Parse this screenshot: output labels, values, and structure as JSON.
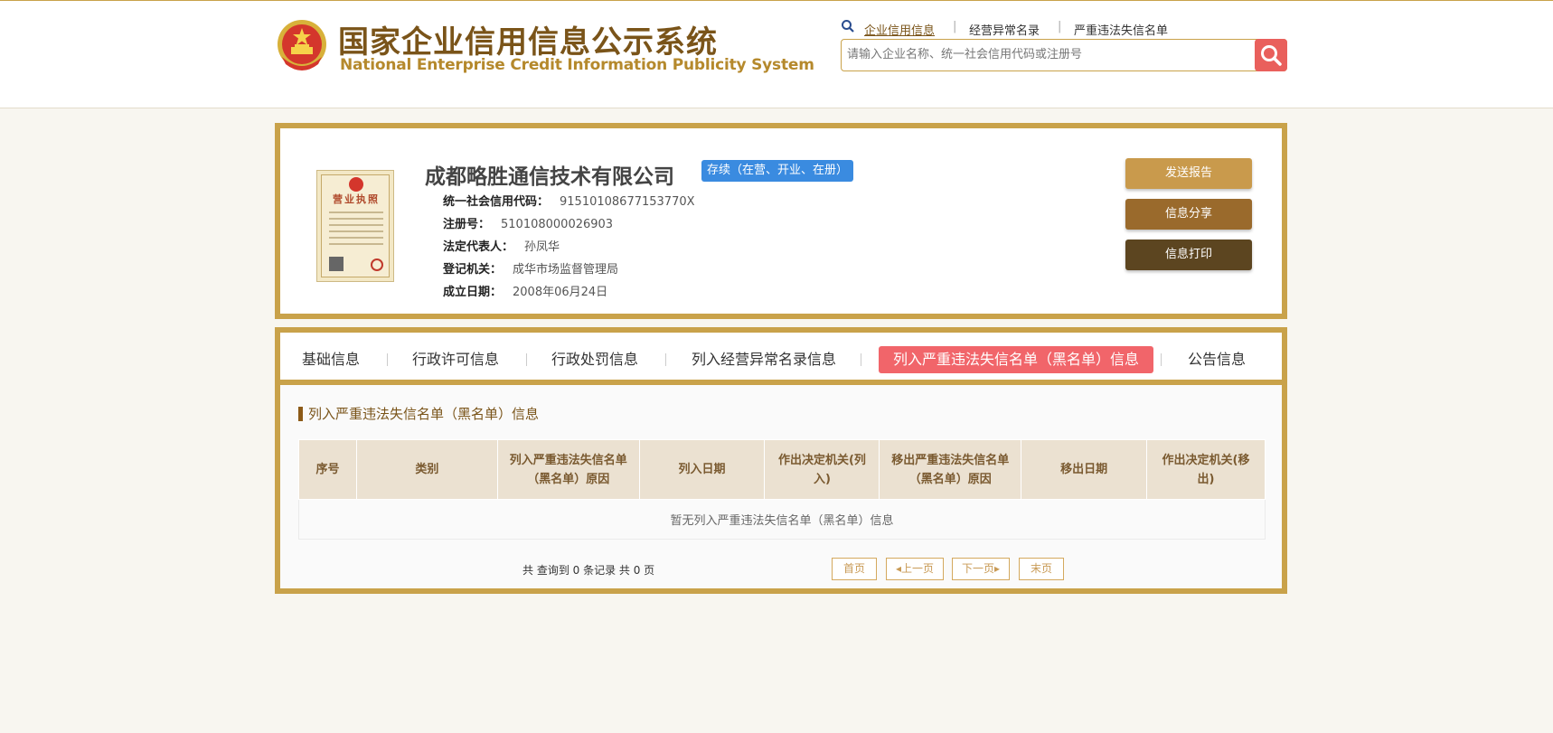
{
  "header": {
    "title_cn": "国家企业信用信息公示系统",
    "title_en": "National Enterprise Credit Information Publicity System",
    "nav": {
      "credit_info": "企业信用信息",
      "abnormal_list": "经营异常名录",
      "blacklist": "严重违法失信名单"
    },
    "search": {
      "placeholder": "请输入企业名称、统一社会信用代码或注册号"
    }
  },
  "company": {
    "name": "成都略胜通信技术有限公司",
    "status": "存续（在营、开业、在册）",
    "license_title": "营业执照",
    "fields": [
      {
        "label": "统一社会信用代码：",
        "value": "91510108677153770X"
      },
      {
        "label": "注册号：",
        "value": "510108000026903"
      },
      {
        "label": "法定代表人：",
        "value": "孙凤华"
      },
      {
        "label": "登记机关：",
        "value": "成华市场监督管理局"
      },
      {
        "label": "成立日期：",
        "value": "2008年06月24日"
      }
    ],
    "actions": {
      "send_report": "发送报告",
      "share": "信息分享",
      "print": "信息打印"
    }
  },
  "tabs": [
    {
      "label": "基础信息"
    },
    {
      "label": "行政许可信息"
    },
    {
      "label": "行政处罚信息"
    },
    {
      "label": "列入经营异常名录信息"
    },
    {
      "label": "列入严重违法失信名单（黑名单）信息"
    },
    {
      "label": "公告信息"
    }
  ],
  "section": {
    "title": "列入严重违法失信名单（黑名单）信息",
    "columns": [
      "序号",
      "类别",
      "列入严重违法失信名单（黑名单）原因",
      "列入日期",
      "作出决定机关(列入)",
      "移出严重违法失信名单（黑名单）原因",
      "移出日期",
      "作出决定机关(移出)"
    ],
    "empty_text": "暂无列入严重违法失信名单（黑名单）信息"
  },
  "pagination": {
    "summary": "共 查询到 0 条记录 共 0 页",
    "first": "首页",
    "prev": "上一页",
    "next": "下一页",
    "last": "末页"
  },
  "colors": {
    "gold": "#c9a24a",
    "brown_title": "#7a5419",
    "send_report_btn": "#c99a4c",
    "share_btn": "#9a6a2c",
    "print_btn": "#5c4520",
    "active_tab": "#f1656a",
    "status_badge": "#3a8be0",
    "search_btn": "#e9605c"
  }
}
